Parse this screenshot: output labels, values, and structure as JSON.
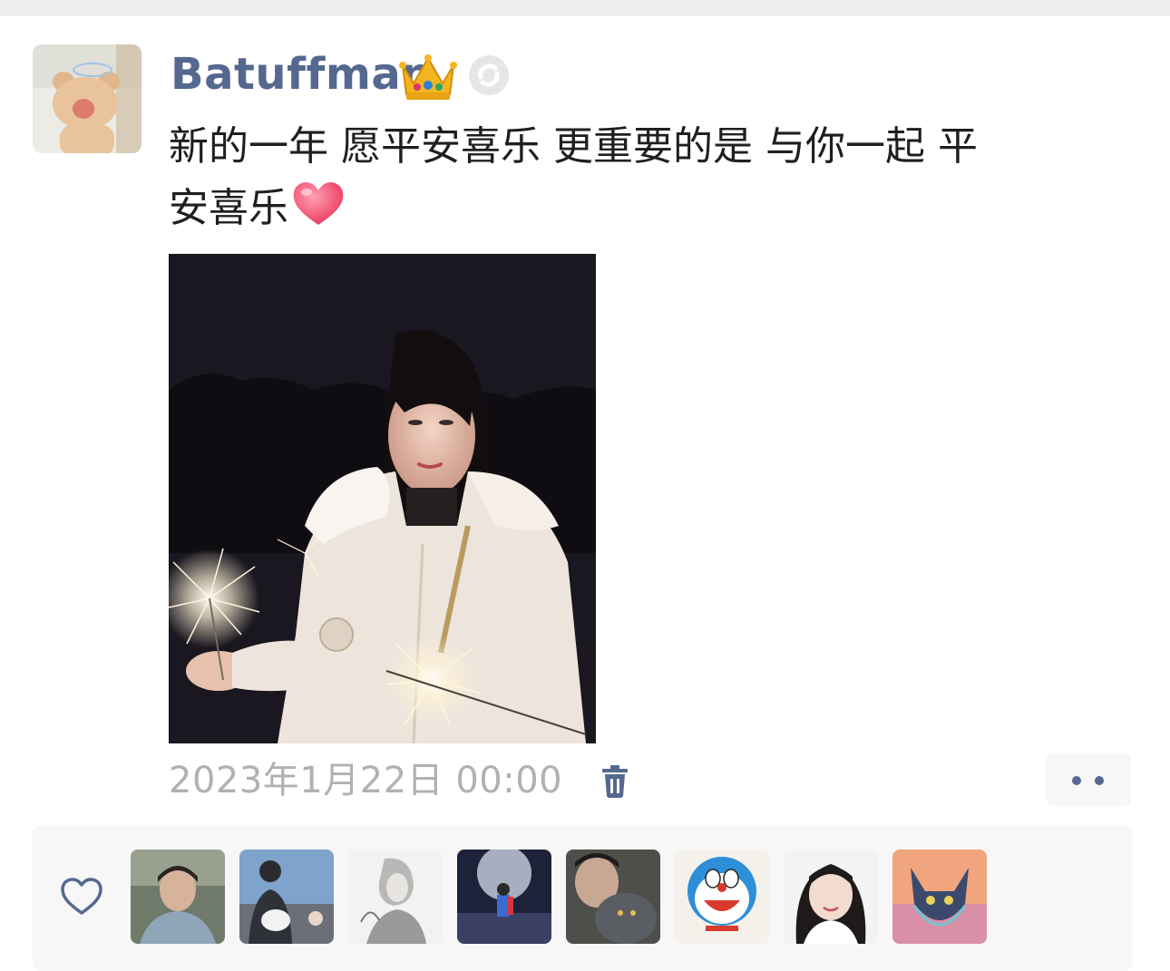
{
  "post": {
    "username": "Batuffman",
    "text_line1": "新的一年 愿平安喜乐 更重要的是 与你一起 平",
    "text_line2": "安喜乐",
    "timestamp": "2023年1月22日 00:00"
  },
  "icons": {
    "author_avatar": "bear-avatar",
    "badge": "crown-icon",
    "status": "sync-icon",
    "emoji": "heart-emoji",
    "delete": "trash-icon",
    "more": "more-dots-icon",
    "like": "heart-outline-icon"
  },
  "likes": {
    "avatars": [
      "liker-avatar-1",
      "liker-avatar-2",
      "liker-avatar-3",
      "liker-avatar-4",
      "liker-avatar-5",
      "liker-avatar-6",
      "liker-avatar-7",
      "liker-avatar-8"
    ]
  },
  "colors": {
    "name_link": "#55688f",
    "timestamp": "#b1b1b1",
    "panel": "#f7f7f7",
    "text": "#1f1f1f"
  }
}
